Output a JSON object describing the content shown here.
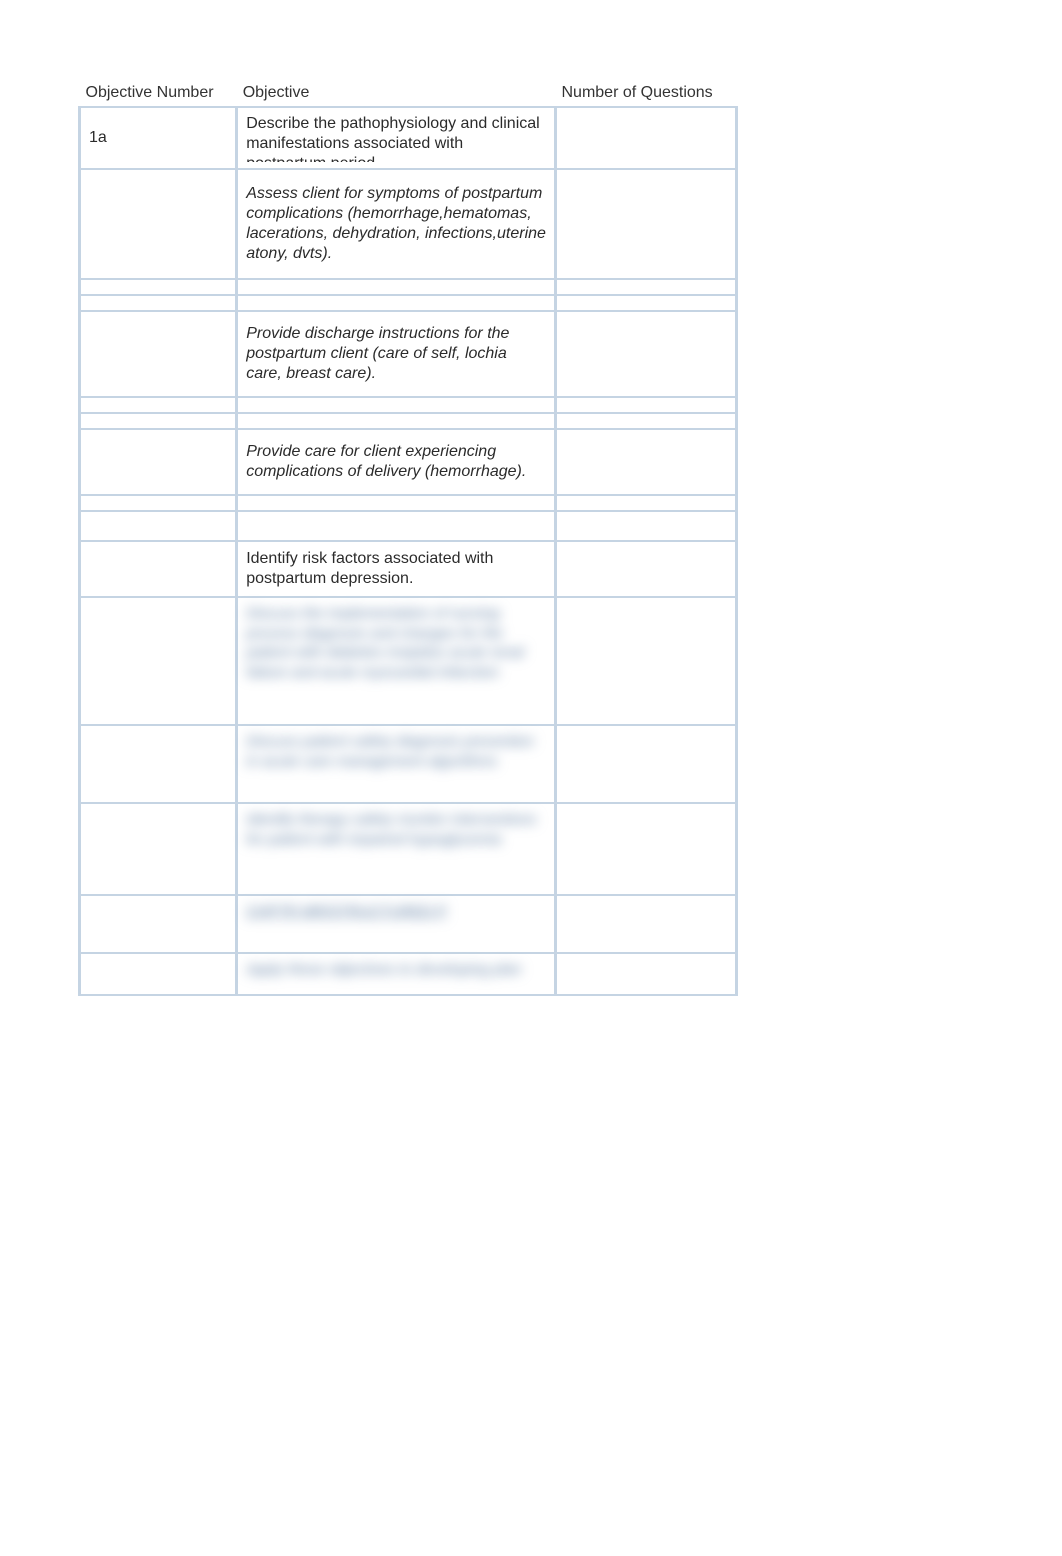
{
  "headers": {
    "col1": "Objective Number",
    "col2": "Objective",
    "col3": "Number of Questions"
  },
  "rows": {
    "r1": {
      "num": "1a",
      "obj_visible": "Describe the pathophysiology and clinical manifestations associated with",
      "obj_cut": "postpartum period"
    },
    "r2": {
      "obj": "Assess client for symptoms of postpartum complications (hemorrhage,hematomas, lacerations, dehydration, infections,uterine atony, dvts)."
    },
    "r3": {
      "obj": "Provide discharge instructions for the postpartum client (care of self, lochia care, breast care)."
    },
    "r4": {
      "obj": "Provide care for client experiencing complications of delivery (hemorrhage)."
    },
    "r5": {
      "obj": "Identify risk factors associated with postpartum depression."
    },
    "blur1": "Discuss the implementation of nursing process diagnosis and changes for the patient with diabetes insipidus acute renal failure and acute myocardial infarction",
    "blur2": "Discuss patient safety diagnosis prevention in acute care management algorithms",
    "blur3": "Identify therapy safety monitor interventions for patient with impaired hypoglycemia",
    "blur4": "CHPTR MR/STRUCTURED P",
    "blur5": "Apply these objectives to developing plan"
  }
}
